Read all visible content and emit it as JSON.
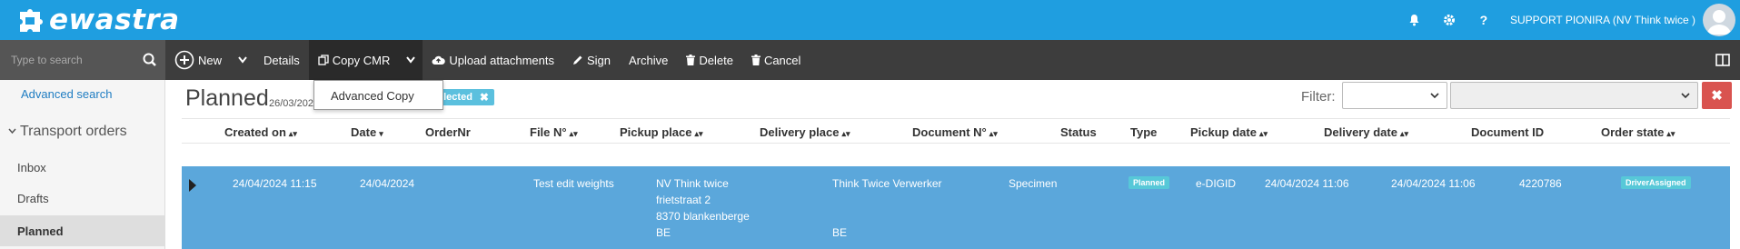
{
  "app": {
    "name": "ewastra"
  },
  "header": {
    "user_name": "SUPPORT PIONIRA (NV Think twice )",
    "help_label": "?"
  },
  "toolbar": {
    "search_placeholder": "Type to search",
    "new_label": "New",
    "details_label": "Details",
    "copy_cmr_label": "Copy CMR",
    "upload_label": "Upload attachments",
    "sign_label": "Sign",
    "archive_label": "Archive",
    "delete_label": "Delete",
    "cancel_label": "Cancel"
  },
  "copy_menu": {
    "items": [
      {
        "label": "Advanced Copy"
      }
    ]
  },
  "sidebar": {
    "advanced_search_label": "Advanced search",
    "group_label": "Transport orders",
    "items": [
      {
        "label": "Inbox"
      },
      {
        "label": "Drafts"
      },
      {
        "label": "Planned"
      }
    ]
  },
  "main": {
    "title": "Planned",
    "date": "26/03/2024",
    "selection_badge": "nt(s) selected",
    "filter_label": "Filter:"
  },
  "table": {
    "columns": [
      {
        "label": "Created on",
        "sort": "both"
      },
      {
        "label": "Date",
        "sort": "desc"
      },
      {
        "label": "OrderNr",
        "sort": "none"
      },
      {
        "label": "File N°",
        "sort": "both"
      },
      {
        "label": "Pickup place",
        "sort": "both"
      },
      {
        "label": "Delivery place",
        "sort": "both"
      },
      {
        "label": "Document N°",
        "sort": "both"
      },
      {
        "label": "Status",
        "sort": "none"
      },
      {
        "label": "Type",
        "sort": "none"
      },
      {
        "label": "Pickup date",
        "sort": "both"
      },
      {
        "label": "Delivery date",
        "sort": "both"
      },
      {
        "label": "Document ID",
        "sort": "none"
      },
      {
        "label": "Order state",
        "sort": "both"
      }
    ],
    "rows": [
      {
        "created_on": "24/04/2024 11:15",
        "date": "24/04/2024",
        "order_nr": "",
        "file_no": "Test edit weights",
        "pickup_place": [
          "NV Think twice",
          "frietstraat 2",
          "8370 blankenberge",
          "BE"
        ],
        "delivery_place": [
          "Think Twice Verwerker",
          "BE"
        ],
        "document_no": "Specimen",
        "status": "Planned",
        "type": "e-DIGID",
        "pickup_date": "24/04/2024 11:06",
        "delivery_date": "24/04/2024 11:06",
        "document_id": "4220786",
        "order_state": "DriverAssigned"
      }
    ]
  },
  "colors": {
    "header_bg": "#1f9ee0",
    "toolbar_bg": "#3d3d3d",
    "selected_row": "#5ba7db",
    "badge": "#57c8d8",
    "danger": "#d9534f"
  }
}
